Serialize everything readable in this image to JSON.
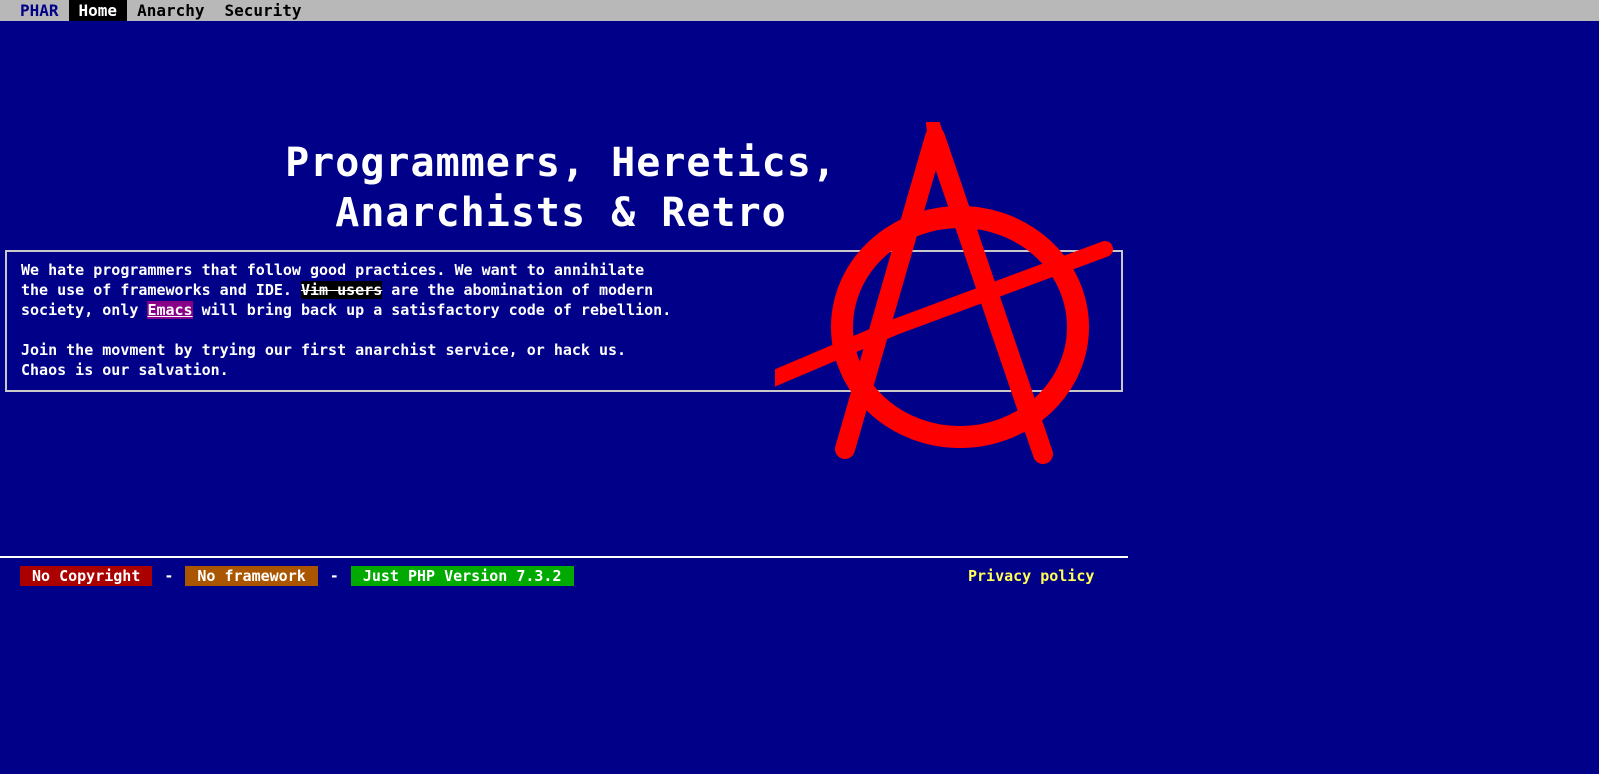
{
  "nav": {
    "brand": "PHAR",
    "items": [
      {
        "label": "Home"
      },
      {
        "label": "Anarchy"
      },
      {
        "label": "Security"
      }
    ]
  },
  "hero": {
    "title": "Programmers, Heretics,\nAnarchists & Retro"
  },
  "intro": {
    "line1": "We hate programmers that follow good practices. We want to annihilate",
    "line2_a": "the use of frameworks and IDE. ",
    "struck": "Vim users",
    "line2_b": " are the abomination of modern",
    "line3_a": "society, only ",
    "emacs_link": "Emacs",
    "line3_b": " will bring back up a satisfactory code of rebellion.",
    "para2_line1": "Join the movment by trying our first anarchist service, or hack us.",
    "para2_line2": "Chaos is our salvation."
  },
  "footer": {
    "badge_copyright": "No Copyright",
    "badge_framework": "No framework",
    "badge_php": "Just PHP Version 7.3.2",
    "separator": "-",
    "privacy": "Privacy policy"
  },
  "colors": {
    "background": "#000088",
    "topbar": "#b8b8b8",
    "anarchy_symbol": "#ff0000",
    "badge_red": "#aa0000",
    "badge_brown": "#aa5500",
    "badge_green": "#00aa00",
    "privacy_link": "#ffff55",
    "emacs_highlight": "#880088"
  },
  "icons": {
    "logo": "anarchy-symbol-icon"
  }
}
